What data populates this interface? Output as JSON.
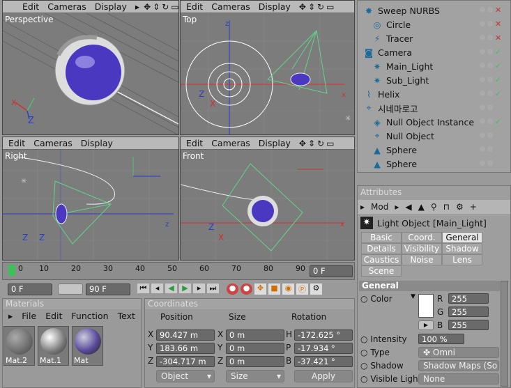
{
  "viewports": {
    "menu": {
      "edit": "Edit",
      "cameras": "Cameras",
      "display": "Display"
    },
    "perspective": "Perspective",
    "top": "Top",
    "right": "Right",
    "front": "Front"
  },
  "timeline": {
    "ticks": [
      "0",
      "10",
      "20",
      "30",
      "40",
      "50",
      "60",
      "70",
      "80",
      "90"
    ],
    "frame_display": "0 F",
    "start_frame": "0 F",
    "end_frame": "90 F"
  },
  "objects": [
    {
      "name": "Sweep NURBS",
      "icon": "sweep-icon",
      "status": "x"
    },
    {
      "name": "Circle",
      "icon": "circle-icon",
      "status": "x"
    },
    {
      "name": "Tracer",
      "icon": "tracer-icon",
      "status": "x"
    },
    {
      "name": "Camera",
      "icon": "camera-icon",
      "status": "check"
    },
    {
      "name": "Main_Light",
      "icon": "light-icon",
      "status": "check"
    },
    {
      "name": "Sub_Light",
      "icon": "light-icon",
      "status": "check"
    },
    {
      "name": "Helix",
      "icon": "helix-icon",
      "status": "check"
    },
    {
      "name": "시네마로고",
      "icon": "null-icon",
      "status": ""
    },
    {
      "name": "Null Object Instance",
      "icon": "instance-icon",
      "status": "check"
    },
    {
      "name": "Null Object",
      "icon": "null-icon",
      "status": ""
    },
    {
      "name": "Sphere",
      "icon": "sphere-icon",
      "status": ""
    },
    {
      "name": "Sphere",
      "icon": "sphere-icon",
      "status": ""
    }
  ],
  "materials": {
    "title": "Materials",
    "menu": {
      "file": "File",
      "edit": "Edit",
      "function": "Function",
      "text": "Text"
    },
    "items": [
      "Mat.2",
      "Mat.1",
      "Mat"
    ]
  },
  "coordinates": {
    "title": "Coordinates",
    "headers": {
      "position": "Position",
      "size": "Size",
      "rotation": "Rotation"
    },
    "rows": [
      {
        "axis": "X",
        "pos": "90.427 m",
        "size_axis": "X",
        "size": "0 m",
        "rot_axis": "H",
        "rot": "-172.625 °"
      },
      {
        "axis": "Y",
        "pos": "183.66 m",
        "size_axis": "Y",
        "size": "0 m",
        "rot_axis": "P",
        "rot": "-17.934 °"
      },
      {
        "axis": "Z",
        "pos": "-304.717 m",
        "size_axis": "Z",
        "size": "0 m",
        "rot_axis": "B",
        "rot": "-37.421 °"
      }
    ],
    "mode": "Object",
    "size_mode": "Size",
    "apply": "Apply"
  },
  "attributes": {
    "title": "Attributes",
    "mode": "Mod",
    "object_title": "Light Object [Main_Light]",
    "tabs": [
      [
        "Basic",
        "Coord.",
        "General"
      ],
      [
        "Details",
        "Visibility",
        "Shadow"
      ],
      [
        "Caustics",
        "Noise",
        "Lens"
      ],
      [
        "Scene"
      ]
    ],
    "section": "General",
    "color_label": "Color",
    "r_label": "R",
    "r": "255",
    "g_label": "G",
    "g": "255",
    "b_label": "B",
    "b": "255",
    "intensity_label": "Intensity",
    "intensity": "100 %",
    "type_label": "Type",
    "type": "Omni",
    "shadow_label": "Shadow",
    "shadow": "Shadow Maps (So",
    "visible_light_label": "Visible Light",
    "visible_light": "None"
  },
  "colors": {
    "viewport_bg": "#7c7c7c",
    "wire_green": "#5fd68a",
    "axis_red": "#d03030",
    "axis_blue": "#2a3cc8",
    "sphere_purple": "#4a38c0"
  }
}
